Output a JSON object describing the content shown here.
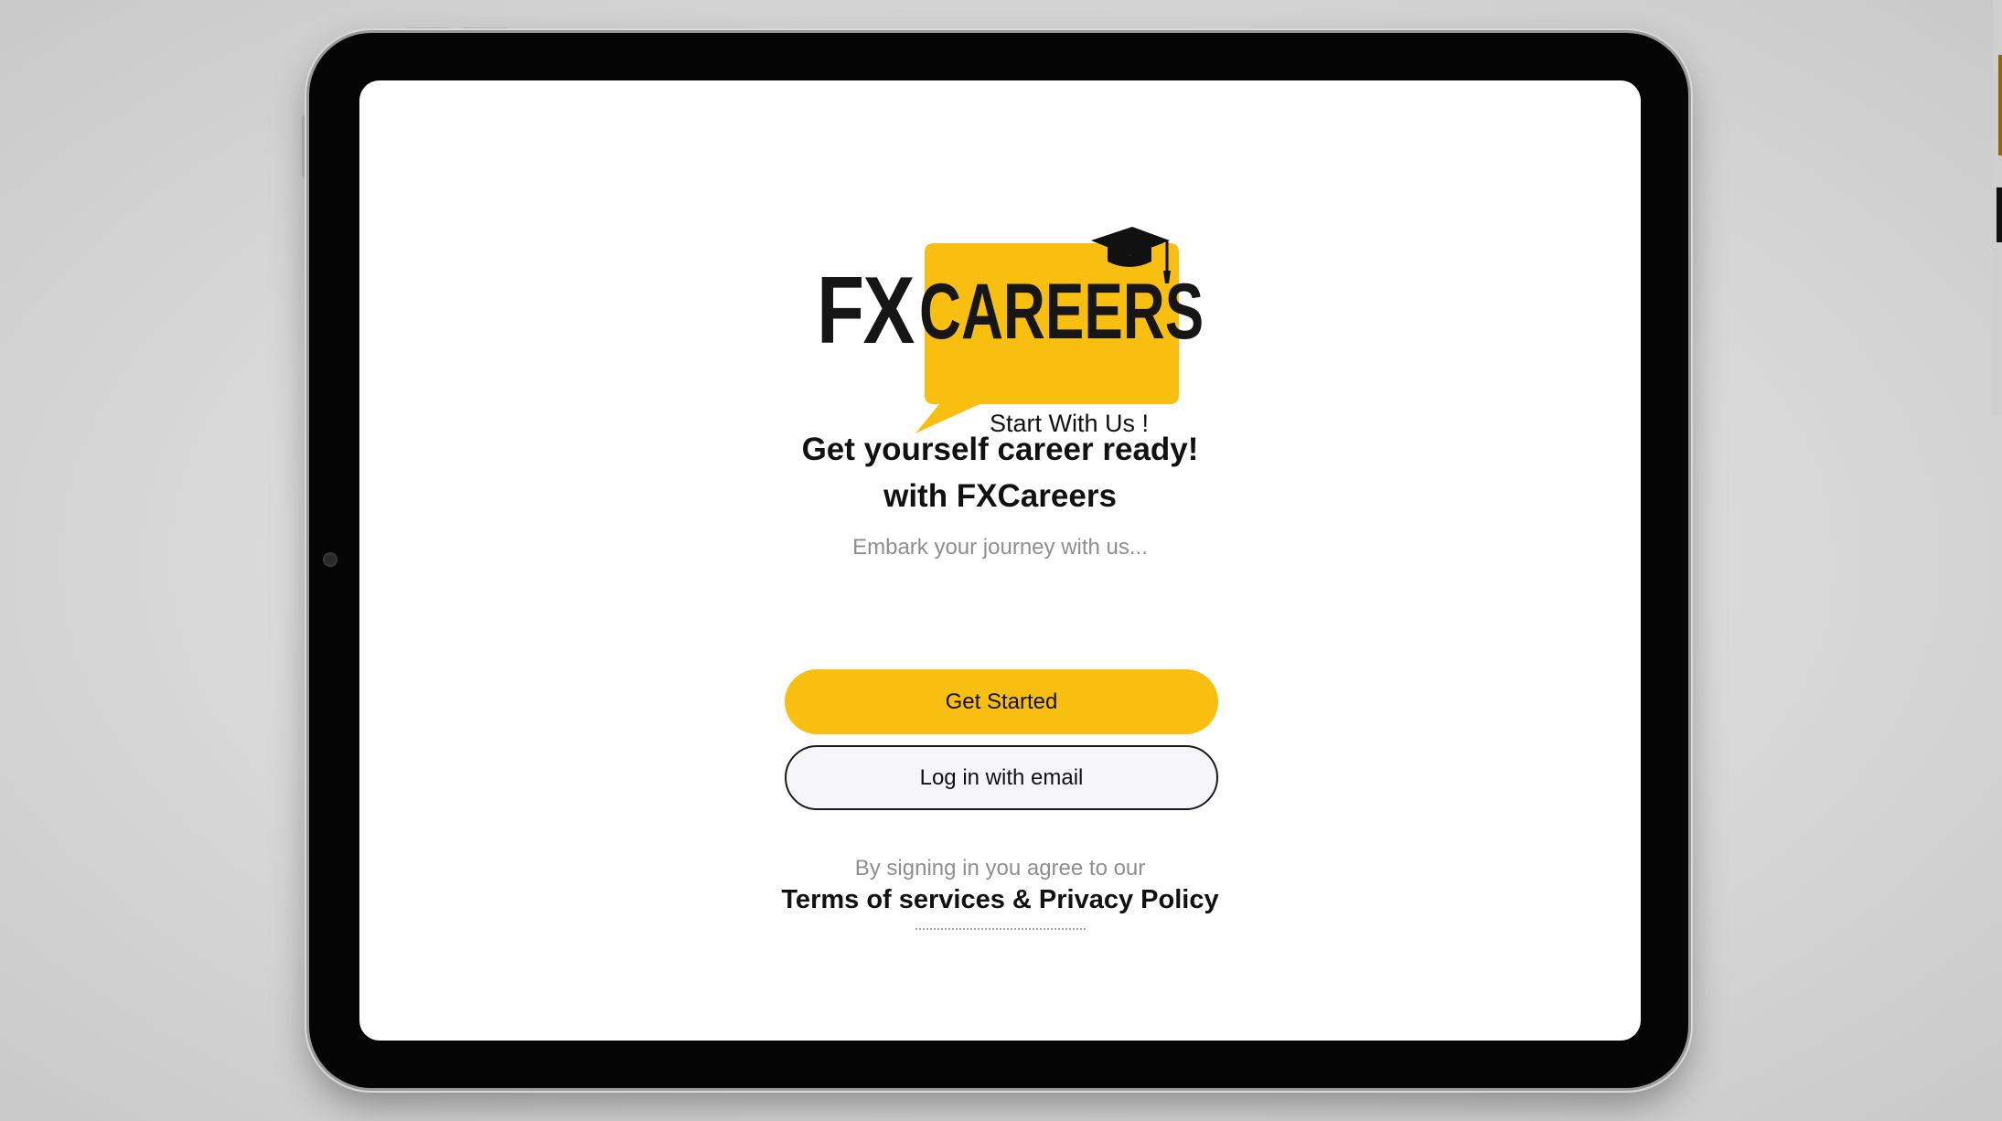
{
  "logo": {
    "brand_left": "FX",
    "brand_right": "CAREERS",
    "tagline": "Start With Us !",
    "colors": {
      "bubble": "#f8bf10",
      "text": "#161616"
    },
    "icon": "graduation-cap-icon"
  },
  "hero": {
    "headline_line1": "Get yourself career ready!",
    "headline_line2": "with FXCareers",
    "subtitle": "Embark your journey with  us..."
  },
  "actions": {
    "get_started_label": "Get Started",
    "login_email_label": "Log in with email"
  },
  "legal": {
    "agree_text": "By signing in you agree to our",
    "terms_link": "Terms of services & Privacy Policy"
  },
  "theme": {
    "accent": "#f8bf10",
    "secondary_button_bg": "#f5f5fa",
    "muted_text": "#8e8e8e"
  }
}
